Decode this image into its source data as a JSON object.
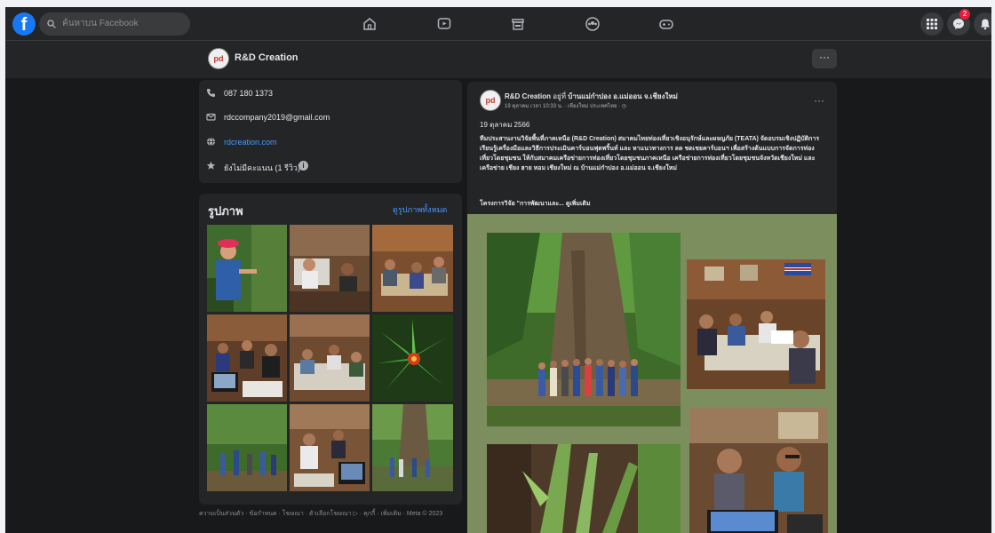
{
  "topbar": {
    "logo": "f",
    "search_placeholder": "ค้นหาบน Facebook",
    "notification_count": "2"
  },
  "page": {
    "avatar_text": "pd",
    "name": "R&D Creation",
    "more_label": "···"
  },
  "intro": {
    "phone": "087 180 1373",
    "email": "rdccompany2019@gmail.com",
    "website": "rdcreation.com",
    "rating": "ยังไม่มีคะแนน (1 รีวิว)",
    "rating_info": "i"
  },
  "photos": {
    "title": "รูปภาพ",
    "see_all": "ดูรูปภาพทั้งหมด"
  },
  "footer": {
    "links": "ความเป็นส่วนตัว · ข้อกำหนด · โฆษณา · ตัวเลือกโฆษณา ▷ · คุกกี้ · เพิ่มเติม · Meta © 2023"
  },
  "post": {
    "avatar_text": "pd",
    "author": "R&D Creation",
    "at_word": "อยู่ที่",
    "location": "บ้านแม่กำปอง อ.แม่ออน จ.เชียงใหม่",
    "meta": "19 ตุลาคม เวลา 10:33 น. · เชียงใหม่ ประเทศไทย · ◷",
    "more_label": "···",
    "date": "19 ตุลาคม 2566",
    "text": "ทีมประสานงานวิจัยพื้นที่ภาคเหนือ (R&D Creation) สมาคมไทยท่องเที่ยวเชิงอนุรักษ์และผจญภัย (TEATA) จัดอบรมเชิงปฏิบัติการ เรียนรู้เครื่องมือและวิธีการประเมินคาร์บอนฟุตพริ้นท์ และ หาแนวทางการ ลด ชดเชยคาร์บอนฯ เพื่อสร้างต้นแบบการจัดการท่องเที่ยวโดยชุมชน ให้กับสมาคมเครือข่ายการท่องเที่ยวโดยชุมชนภาคเหนือ เครือข่ายการท่องเที่ยวโดยชุมชนจังหวัดเชียงใหม่ และ เครือข่าย เชียง ฮาย หอม เชียงใหม่ ณ บ้านแม่กำปอง อ.แม่ออน จ.เชียงใหม่",
    "project": "โครงการวิจัย \"การพัฒนาและ... ดูเพิ่มเติม"
  },
  "colors": {
    "background": "#18191a",
    "card": "#242526",
    "accent": "#1877f2",
    "link": "#4599ff",
    "gallery_bg": "#7d8e5e"
  }
}
